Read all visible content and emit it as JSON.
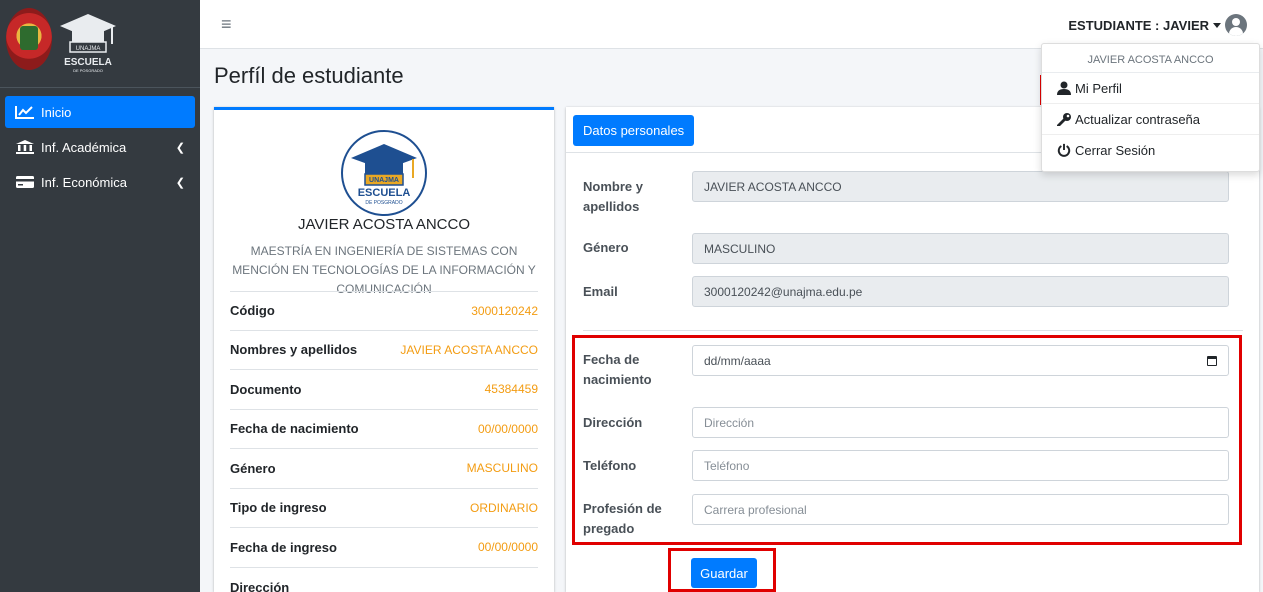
{
  "sidebar": {
    "items": [
      {
        "label": "Inicio",
        "icon": "chart-line-icon"
      },
      {
        "label": "Inf. Académica",
        "icon": "university-icon"
      },
      {
        "label": "Inf. Económica",
        "icon": "credit-card-icon"
      }
    ],
    "logo_text": {
      "top": "UNAJMA",
      "main": "ESCUELA",
      "sub": "DE POSGRADO"
    }
  },
  "topbar": {
    "user_label": "ESTUDIANTE : JAVIER"
  },
  "dropdown": {
    "header": "JAVIER ACOSTA ANCCO",
    "items": [
      {
        "label": "Mi Perfil"
      },
      {
        "label": "Actualizar contraseña"
      },
      {
        "label": "Cerrar Sesión"
      }
    ]
  },
  "page": {
    "title": "Perfíl de estudiante"
  },
  "profile": {
    "logo_text": {
      "top": "UNAJMA",
      "main": "ESCUELA",
      "sub": "DE POSGRADO"
    },
    "name": "JAVIER ACOSTA ANCCO",
    "program": "MAESTRÍA EN INGENIERÍA DE SISTEMAS CON MENCIÓN EN TECNOLOGÍAS DE LA INFORMACIÓN Y COMUNICACIÓN",
    "info": [
      {
        "label": "Código",
        "value": "3000120242"
      },
      {
        "label": "Nombres y apellidos",
        "value": "JAVIER ACOSTA ANCCO"
      },
      {
        "label": "Documento",
        "value": "45384459"
      },
      {
        "label": "Fecha de nacimiento",
        "value": "00/00/0000"
      },
      {
        "label": "Género",
        "value": "MASCULINO"
      },
      {
        "label": "Tipo de ingreso",
        "value": "ORDINARIO"
      },
      {
        "label": "Fecha de ingreso",
        "value": "00/00/0000"
      },
      {
        "label": "Dirección",
        "value": ""
      }
    ]
  },
  "form": {
    "tab_label": "Datos personales",
    "name_label": "Nombre y apellidos",
    "name_value": "JAVIER ACOSTA ANCCO",
    "gender_label": "Género",
    "gender_value": "MASCULINO",
    "email_label": "Email",
    "email_value": "3000120242@unajma.edu.pe",
    "birth_label": "Fecha de nacimiento",
    "birth_placeholder": "dd/mm/aaaa",
    "address_label": "Dirección",
    "address_placeholder": "Dirección",
    "phone_label": "Teléfono",
    "phone_placeholder": "Teléfono",
    "profession_label": "Profesión de pregado",
    "profession_placeholder": "Carrera profesional",
    "save_label": "Guardar"
  },
  "colors": {
    "primary": "#007bff",
    "sidebar": "#343a40",
    "value_orange": "#f39c12",
    "highlight_red": "#e00000"
  }
}
